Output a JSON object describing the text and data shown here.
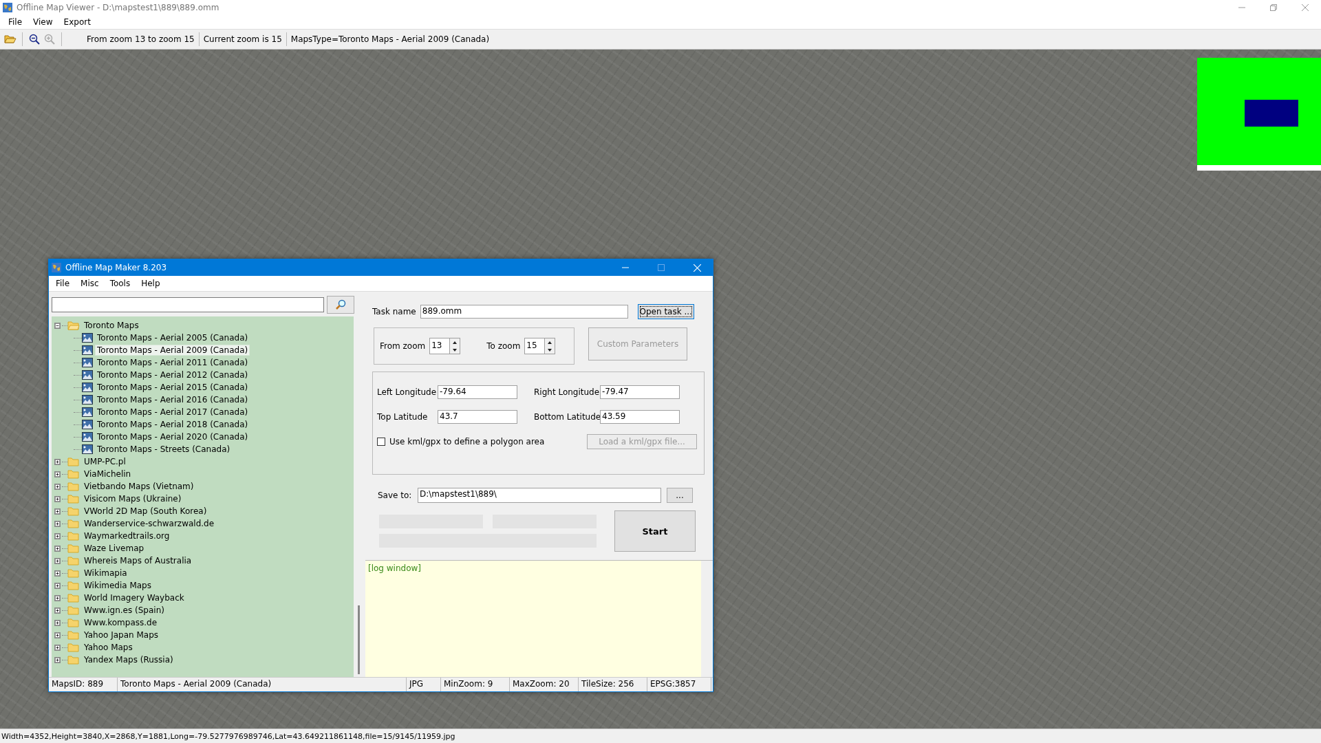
{
  "window": {
    "title": "Offline Map Viewer - D:\\mapstest1\\889\\889.omm"
  },
  "menu": [
    "File",
    "View",
    "Export"
  ],
  "toolbar": {
    "texts": [
      "From zoom 13 to zoom 15",
      "Current zoom is 15",
      "MapsType=Toronto Maps - Aerial 2009 (Canada)"
    ]
  },
  "dialog": {
    "title": "Offline Map Maker 8.203",
    "menu": [
      "File",
      "Misc",
      "Tools",
      "Help"
    ],
    "tree": [
      {
        "label": "Toronto Maps",
        "expanded": true,
        "selected": false,
        "children": [
          {
            "label": "Toronto Maps - Aerial 2005 (Canada)",
            "selected": false
          },
          {
            "label": "Toronto Maps - Aerial 2009 (Canada)",
            "selected": true
          },
          {
            "label": "Toronto Maps - Aerial 2011 (Canada)",
            "selected": false
          },
          {
            "label": "Toronto Maps - Aerial 2012 (Canada)",
            "selected": false
          },
          {
            "label": "Toronto Maps - Aerial 2015 (Canada)",
            "selected": false
          },
          {
            "label": "Toronto Maps - Aerial 2016 (Canada)",
            "selected": false
          },
          {
            "label": "Toronto Maps - Aerial 2017 (Canada)",
            "selected": false
          },
          {
            "label": "Toronto Maps - Aerial 2018 (Canada)",
            "selected": false
          },
          {
            "label": "Toronto Maps - Aerial 2020 (Canada)",
            "selected": false
          },
          {
            "label": "Toronto Maps - Streets (Canada)",
            "selected": false
          }
        ]
      },
      {
        "label": "UMP-PC.pl",
        "expanded": false,
        "selected": false
      },
      {
        "label": "ViaMichelin",
        "expanded": false,
        "selected": false
      },
      {
        "label": "Vietbando Maps (Vietnam)",
        "expanded": false,
        "selected": false
      },
      {
        "label": "Visicom Maps (Ukraine)",
        "expanded": false,
        "selected": false
      },
      {
        "label": "VWorld 2D Map (South Korea)",
        "expanded": false,
        "selected": false
      },
      {
        "label": "Wanderservice-schwarzwald.de",
        "expanded": false,
        "selected": false
      },
      {
        "label": "Waymarkedtrails.org",
        "expanded": false,
        "selected": false
      },
      {
        "label": "Waze Livemap",
        "expanded": false,
        "selected": false
      },
      {
        "label": "Whereis Maps of Australia",
        "expanded": false,
        "selected": false
      },
      {
        "label": "Wikimapia",
        "expanded": false,
        "selected": false
      },
      {
        "label": "Wikimedia Maps",
        "expanded": false,
        "selected": false
      },
      {
        "label": "World Imagery Wayback",
        "expanded": false,
        "selected": false
      },
      {
        "label": "Www.ign.es (Spain)",
        "expanded": false,
        "selected": false
      },
      {
        "label": "Www.kompass.de",
        "expanded": false,
        "selected": false
      },
      {
        "label": "Yahoo Japan Maps",
        "expanded": false,
        "selected": false
      },
      {
        "label": "Yahoo Maps",
        "expanded": false,
        "selected": false
      },
      {
        "label": "Yandex Maps (Russia)",
        "expanded": false,
        "selected": false
      }
    ],
    "task_name": {
      "label": "Task name",
      "value": "889.omm"
    },
    "open_task_button": "Open task ...",
    "from_zoom": {
      "label": "From zoom",
      "value": "13"
    },
    "to_zoom": {
      "label": "To zoom",
      "value": "15"
    },
    "custom_parameters_button": {
      "label": "Custom Parameters",
      "disabled": true
    },
    "left_longitude": {
      "label": "Left Longitude",
      "value": "-79.64"
    },
    "right_longitude": {
      "label": "Right Longitude",
      "value": "-79.47"
    },
    "top_latitude": {
      "label": "Top Latitude",
      "value": "43.7"
    },
    "bottom_latitude": {
      "label": "Bottom Latitude",
      "value": "43.59"
    },
    "kml_checkbox": {
      "label": "Use kml/gpx to define a polygon area",
      "checked": false
    },
    "load_kml_button": {
      "label": "Load a kml/gpx file...",
      "disabled": true
    },
    "save_to": {
      "label": "Save to:",
      "value": "D:\\mapstest1\\889\\"
    },
    "browse_button": "...",
    "progress": [
      {
        "level": 0
      },
      {
        "level": 0
      },
      {
        "level": 0
      }
    ],
    "start_button": "Start",
    "log": "[log window]",
    "status_bar": [
      "MapsID: 889",
      "Toronto Maps - Aerial 2009 (Canada)",
      "JPG",
      "MinZoom: 9",
      "MaxZoom: 20",
      "TileSize: 256",
      "EPSG:3857"
    ]
  },
  "status_bar": "Width=4352,Height=3840,X=2868,Y=1881,Long=-79.5277976989746,Lat=43.649211861148,file=15/9145/11959.jpg"
}
